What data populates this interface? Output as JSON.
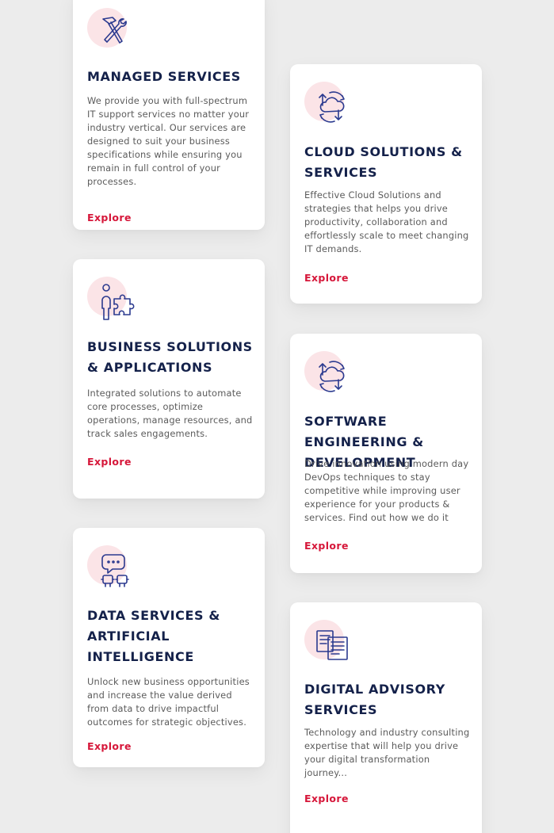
{
  "colors": {
    "page_background": "#ececec",
    "card_background": "#ffffff",
    "title": "#14214a",
    "body_text": "#5b5b5b",
    "accent_link": "#d6173a",
    "icon_blob": "#fbe4e7",
    "icon_stroke": "#2b3a8f"
  },
  "cards": [
    {
      "icon": "tools-hammer-wrench-icon",
      "title": "MANAGED SERVICES",
      "description": "We provide you with full-spectrum IT support services no matter your industry vertical. Our services are designed to suit your business specifications while ensuring you remain in full control of your processes.",
      "link": "Explore"
    },
    {
      "icon": "cloud-sync-icon",
      "title": "CLOUD SOLUTIONS & SERVICES",
      "description": "Effective Cloud Solutions and strategies that helps you drive productivity, collaboration and effortlessly scale to meet changing IT demands.",
      "link": "Explore"
    },
    {
      "icon": "person-puzzle-icon",
      "title": "BUSINESS SOLUTIONS & APPLICATIONS",
      "description": "Integrated solutions to automate core processes, optimize operations, manage resources, and track sales engagements.",
      "link": "Explore"
    },
    {
      "icon": "cloud-sync-icon",
      "title": "SOFTWARE ENGINEERING & DEVELOPMENT",
      "description": "Drive innovation using modern day DevOps techniques to stay competitive while improving user experience for your products & services. Find out how we do it",
      "link": "Explore"
    },
    {
      "icon": "chat-robots-icon",
      "title": "DATA SERVICES & ARTIFICIAL INTELLIGENCE",
      "description": "Unlock new business opportunities and increase the value derived from data to drive impactful outcomes for strategic objectives.",
      "link": "Explore"
    },
    {
      "icon": "documents-icon",
      "title": "DIGITAL ADVISORY SERVICES",
      "description": "Technology and industry consulting expertise that will help you drive your digital transformation journey...",
      "link": "Explore"
    }
  ]
}
